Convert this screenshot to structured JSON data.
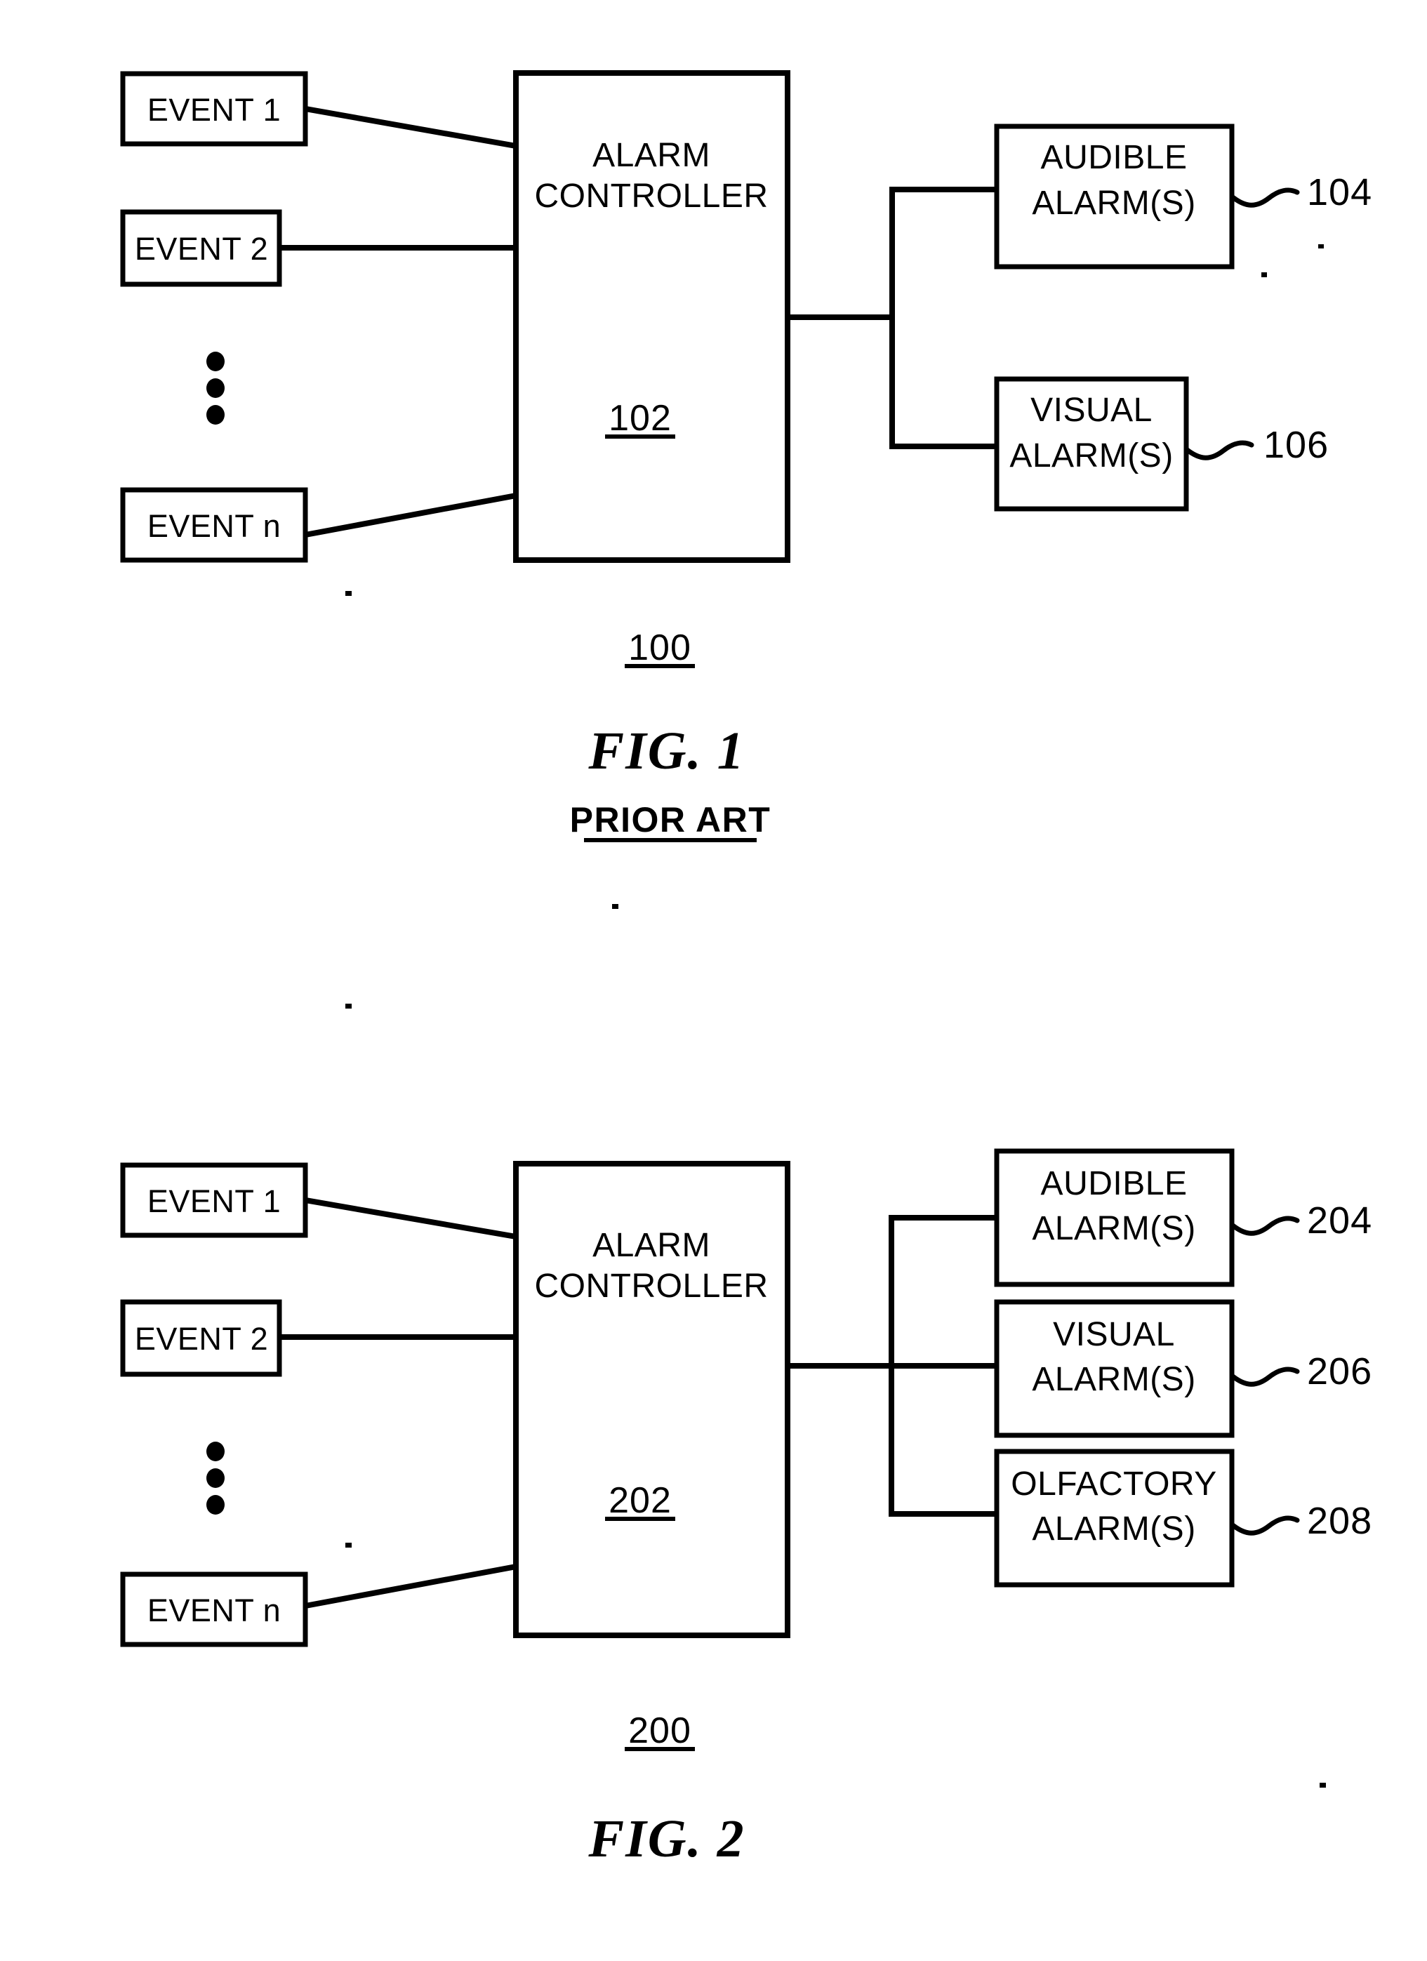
{
  "document": {
    "type": "patent-drawing-sheet",
    "background_color": "#ffffff",
    "ink_color": "#000000",
    "figures": [
      {
        "id": "figure-1",
        "caption": "FIG.  1",
        "subcaption": "PRIOR ART",
        "system_label": "100",
        "controller": {
          "line1": "ALARM",
          "line2": "CONTROLLER",
          "ref": "102"
        },
        "inputs": [
          {
            "label": "EVENT  1"
          },
          {
            "label": "EVENT  2"
          },
          {
            "label": "EVENT  n"
          }
        ],
        "ellipsis": "vertical-three-dots",
        "outputs": [
          {
            "line1": "AUDIBLE",
            "line2": "ALARM(S)",
            "ref": "104"
          },
          {
            "line1": "VISUAL",
            "line2": "ALARM(S)",
            "ref": "106"
          }
        ]
      },
      {
        "id": "figure-2",
        "caption": "FIG.  2",
        "subcaption": "",
        "system_label": "200",
        "controller": {
          "line1": "ALARM",
          "line2": "CONTROLLER",
          "ref": "202"
        },
        "inputs": [
          {
            "label": "EVENT  1"
          },
          {
            "label": "EVENT  2"
          },
          {
            "label": "EVENT  n"
          }
        ],
        "ellipsis": "vertical-three-dots",
        "outputs": [
          {
            "line1": "AUDIBLE",
            "line2": "ALARM(S)",
            "ref": "204"
          },
          {
            "line1": "VISUAL",
            "line2": "ALARM(S)",
            "ref": "206"
          },
          {
            "line1": "OLFACTORY",
            "line2": "ALARM(S)",
            "ref": "208"
          }
        ]
      }
    ]
  }
}
